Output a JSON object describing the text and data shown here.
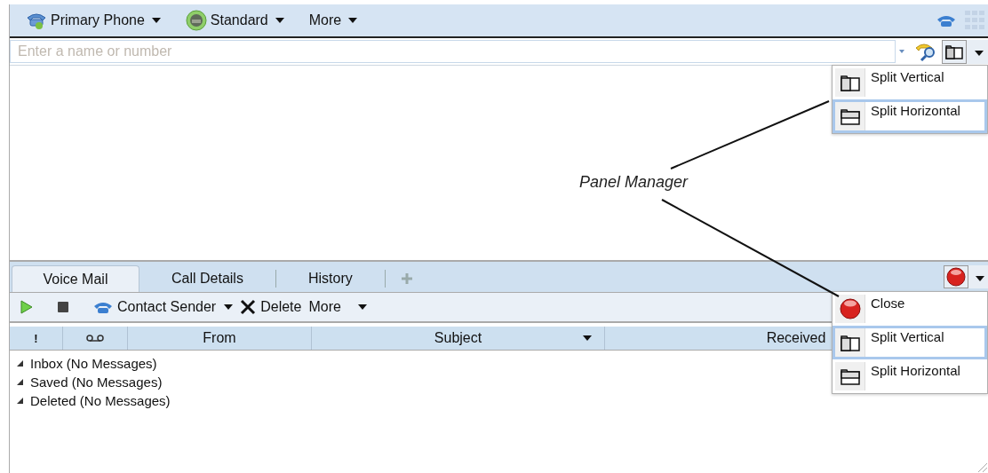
{
  "toolbar": {
    "phone": "Primary Phone",
    "mode": "Standard",
    "more": "More"
  },
  "search": {
    "placeholder": "Enter a name or number"
  },
  "tabs": [
    {
      "label": "Voice Mail",
      "selected": true
    },
    {
      "label": "Call Details",
      "selected": false
    },
    {
      "label": "History",
      "selected": false
    }
  ],
  "actions": {
    "contact": "Contact Sender",
    "delete": "Delete",
    "more": "More"
  },
  "columns": [
    {
      "kind": "flag",
      "label": "!"
    },
    {
      "kind": "voicemail"
    },
    {
      "kind": "text",
      "label": "From"
    },
    {
      "kind": "sortable",
      "label": "Subject"
    },
    {
      "kind": "text",
      "label": "Received"
    }
  ],
  "folders": [
    {
      "label": "Inbox (No Messages)",
      "expanded": true
    },
    {
      "label": "Saved (No Messages)",
      "expanded": true
    },
    {
      "label": "Deleted (No Messages)",
      "expanded": true
    }
  ],
  "panel_menus": [
    {
      "items": [
        {
          "kind": "split-vertical",
          "label": "Split Vertical",
          "selected": false
        },
        {
          "kind": "split-horizontal",
          "label": "Split Horizontal",
          "selected": true
        }
      ]
    },
    {
      "items": [
        {
          "kind": "close",
          "label": "Close",
          "selected": false
        },
        {
          "kind": "split-vertical",
          "label": "Split Vertical",
          "selected": true
        },
        {
          "kind": "split-horizontal",
          "label": "Split Horizontal",
          "selected": false
        }
      ]
    }
  ],
  "annotation": {
    "label": "Panel Manager"
  }
}
